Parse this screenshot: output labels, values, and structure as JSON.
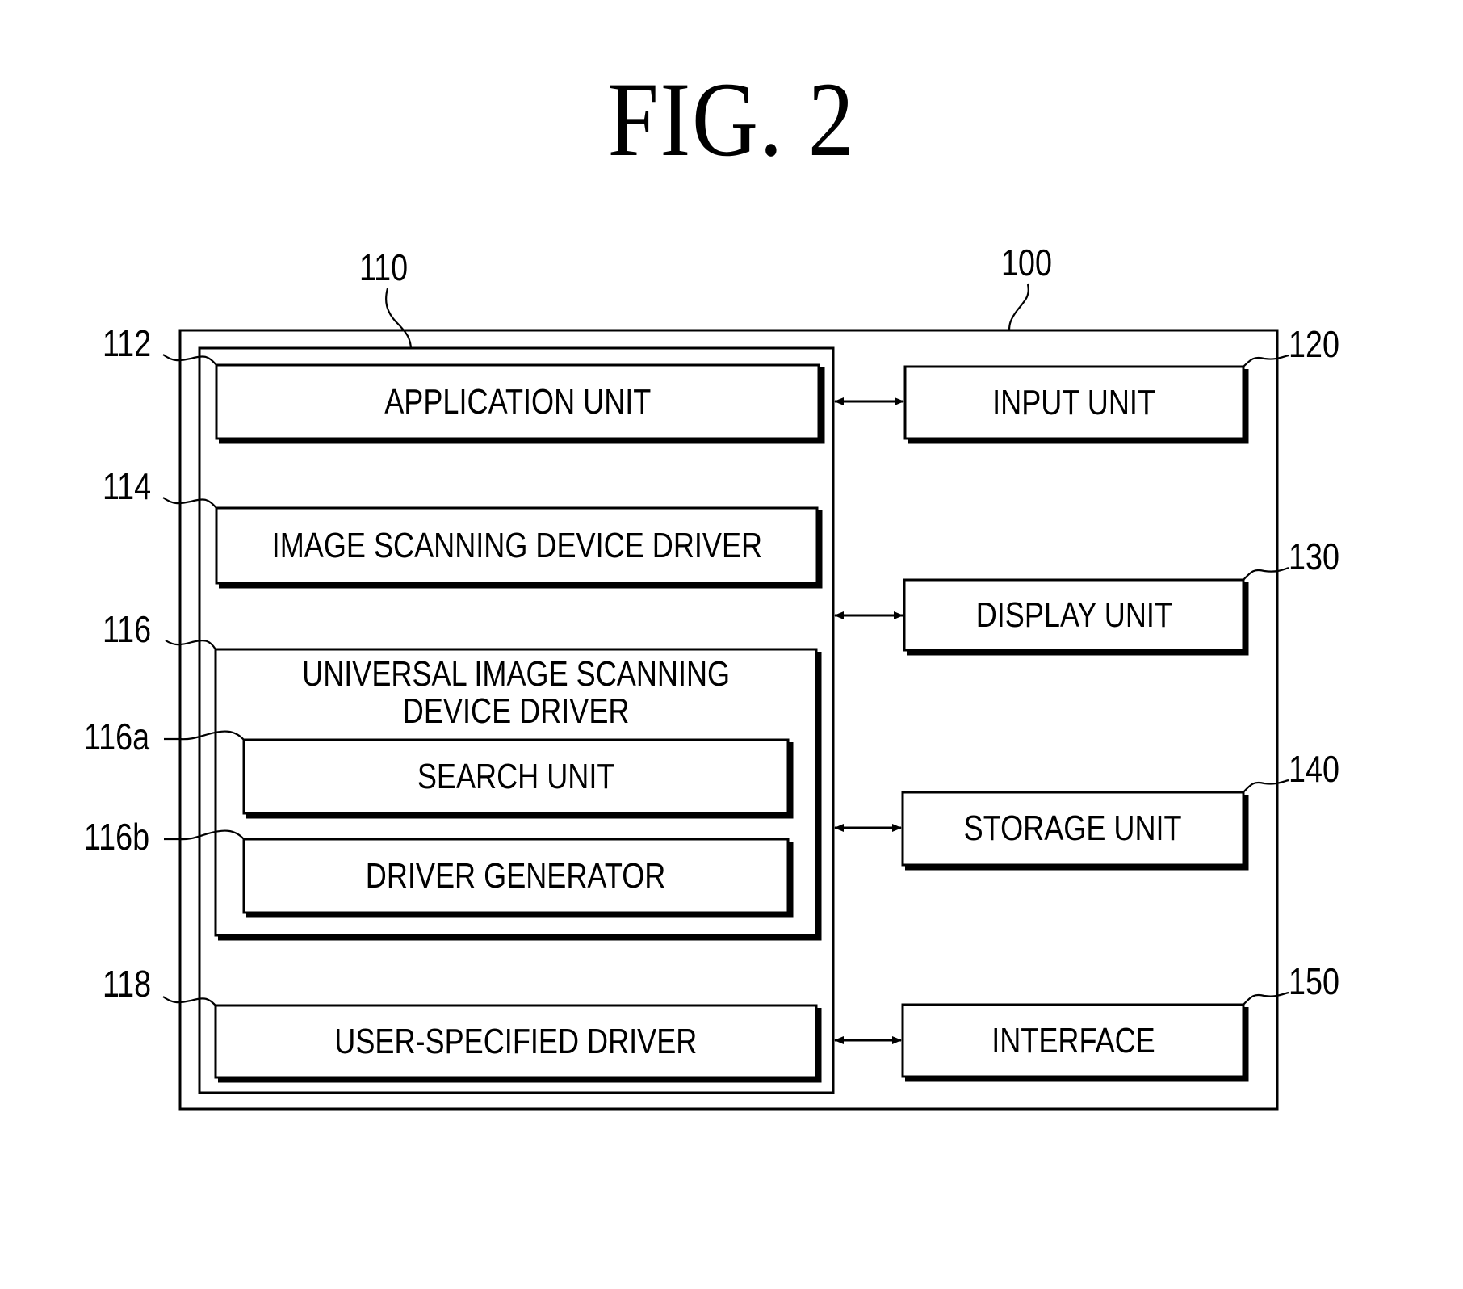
{
  "figure": {
    "title": "FIG. 2"
  },
  "system": {
    "ref": "100",
    "controller": {
      "ref": "110",
      "blocks": [
        {
          "id": "application_unit",
          "ref": "112",
          "label": "APPLICATION UNIT"
        },
        {
          "id": "image_scanning_device_driver",
          "ref": "114",
          "label": "IMAGE SCANNING DEVICE DRIVER"
        },
        {
          "id": "universal_image_scanning_device_driver",
          "ref": "116",
          "label_line1": "UNIVERSAL IMAGE SCANNING",
          "label_line2": "DEVICE DRIVER",
          "sub_blocks": [
            {
              "id": "search_unit",
              "ref": "116a",
              "label": "SEARCH UNIT"
            },
            {
              "id": "driver_generator",
              "ref": "116b",
              "label": "DRIVER GENERATOR"
            }
          ]
        },
        {
          "id": "user_specified_driver",
          "ref": "118",
          "label": "USER-SPECIFIED DRIVER"
        }
      ]
    },
    "peripherals": [
      {
        "id": "input_unit",
        "ref": "120",
        "label": "INPUT UNIT"
      },
      {
        "id": "display_unit",
        "ref": "130",
        "label": "DISPLAY UNIT"
      },
      {
        "id": "storage_unit",
        "ref": "140",
        "label": "STORAGE UNIT"
      },
      {
        "id": "interface",
        "ref": "150",
        "label": "INTERFACE"
      }
    ],
    "connections": [
      {
        "from": "controller",
        "to": "input_unit",
        "type": "bidirectional"
      },
      {
        "from": "controller",
        "to": "display_unit",
        "type": "bidirectional"
      },
      {
        "from": "controller",
        "to": "storage_unit",
        "type": "bidirectional"
      },
      {
        "from": "controller",
        "to": "interface",
        "type": "bidirectional"
      }
    ]
  },
  "colors": {
    "ink": "#000000",
    "background": "#ffffff"
  }
}
